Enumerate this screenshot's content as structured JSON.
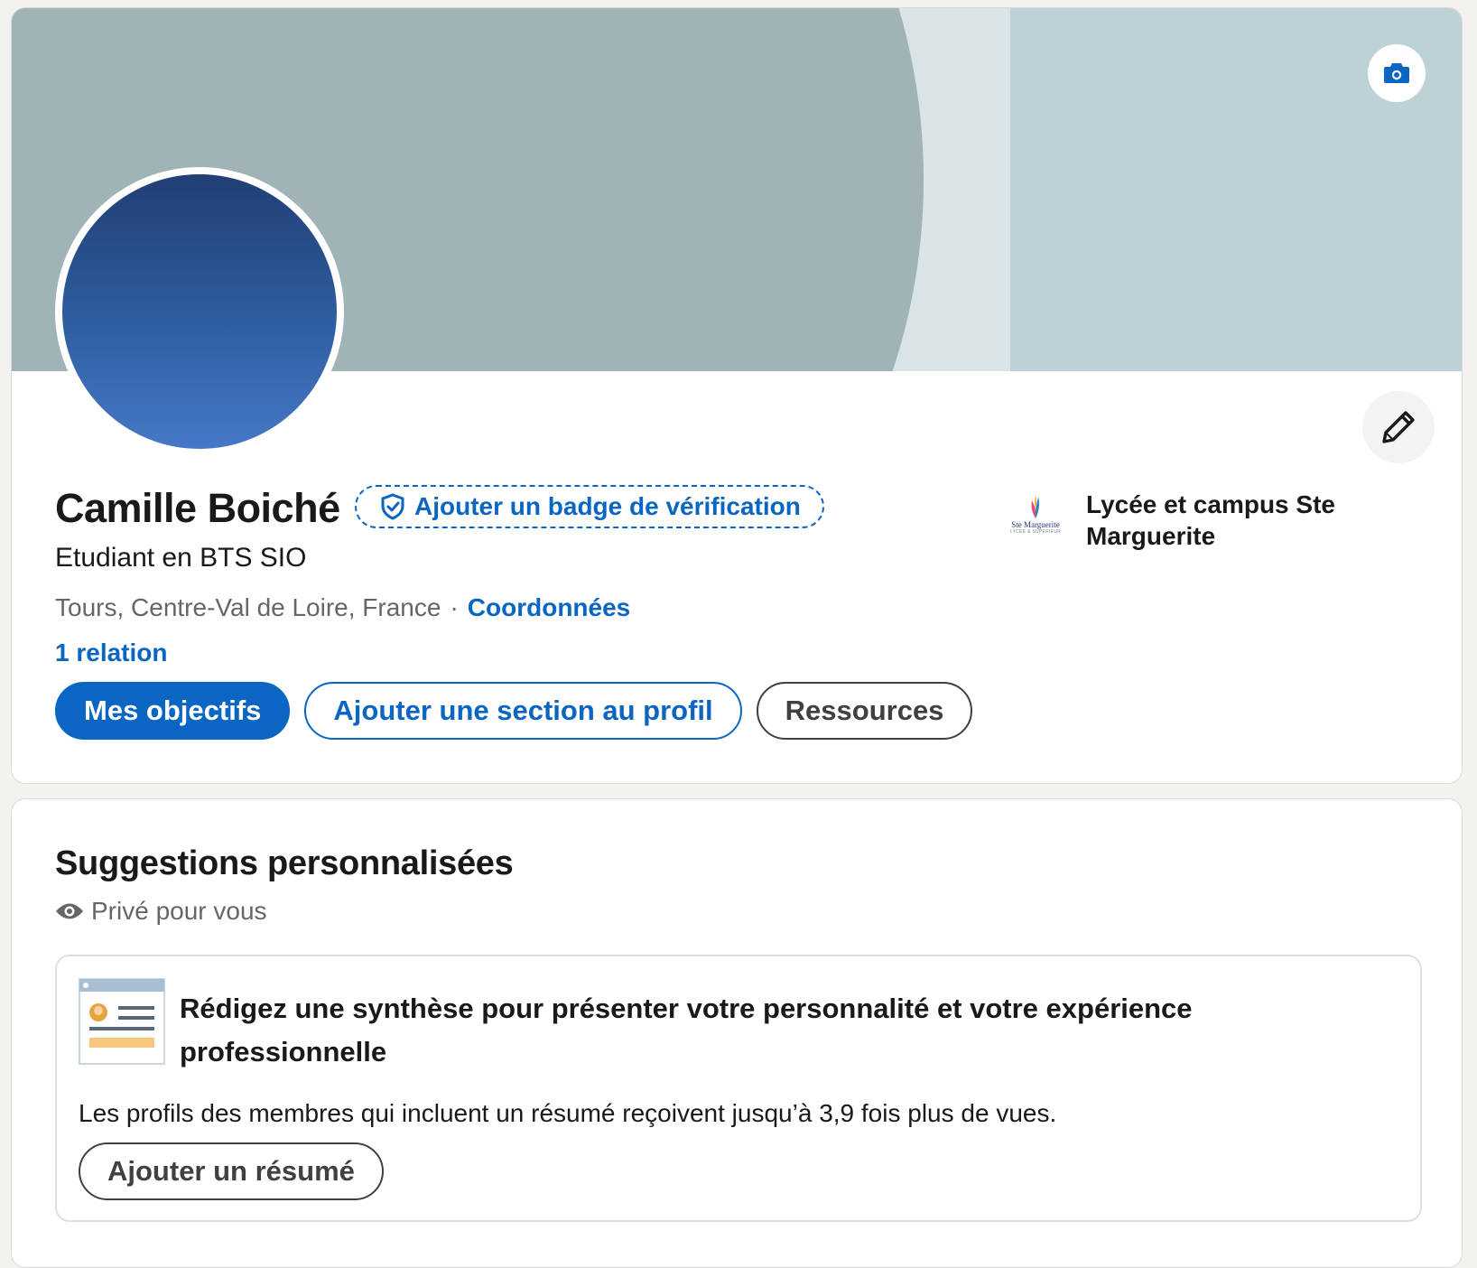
{
  "profile": {
    "name": "Camille Boiché",
    "verification_badge_label": "Ajouter un badge de vérification",
    "headline": "Etudiant en BTS SIO",
    "location": "Tours, Centre-Val de Loire, France",
    "separator": "·",
    "contact_info_label": "Coordonnées",
    "connections": "1 relation",
    "school": {
      "name": "Lycée et campus Ste Marguerite",
      "logo_text": "Ste Marguerite",
      "logo_subtext": "LYCÉE & SUPÉRIEUR"
    },
    "actions": {
      "goals": "Mes objectifs",
      "add_section": "Ajouter une section au profil",
      "resources": "Ressources"
    },
    "icons": {
      "banner_edit": "camera-icon",
      "profile_edit": "pencil-icon",
      "verification": "shield-check-icon"
    }
  },
  "suggestions": {
    "title": "Suggestions personnalisées",
    "visibility": "Privé pour vous",
    "card": {
      "title": "Rédigez une synthèse pour présenter votre personnalité et votre expérience professionnelle",
      "description": "Les profils des membres qui incluent un résumé reçoivent jusqu’à 3,9 fois plus de vues.",
      "button": "Ajouter un résumé"
    }
  },
  "colors": {
    "brand_blue": "#0a66c2",
    "page_bg": "#f4f2ee",
    "banner_dark": "#a0b3b6",
    "banner_light": "#dae3e5",
    "banner_right": "#bdd2d6"
  }
}
